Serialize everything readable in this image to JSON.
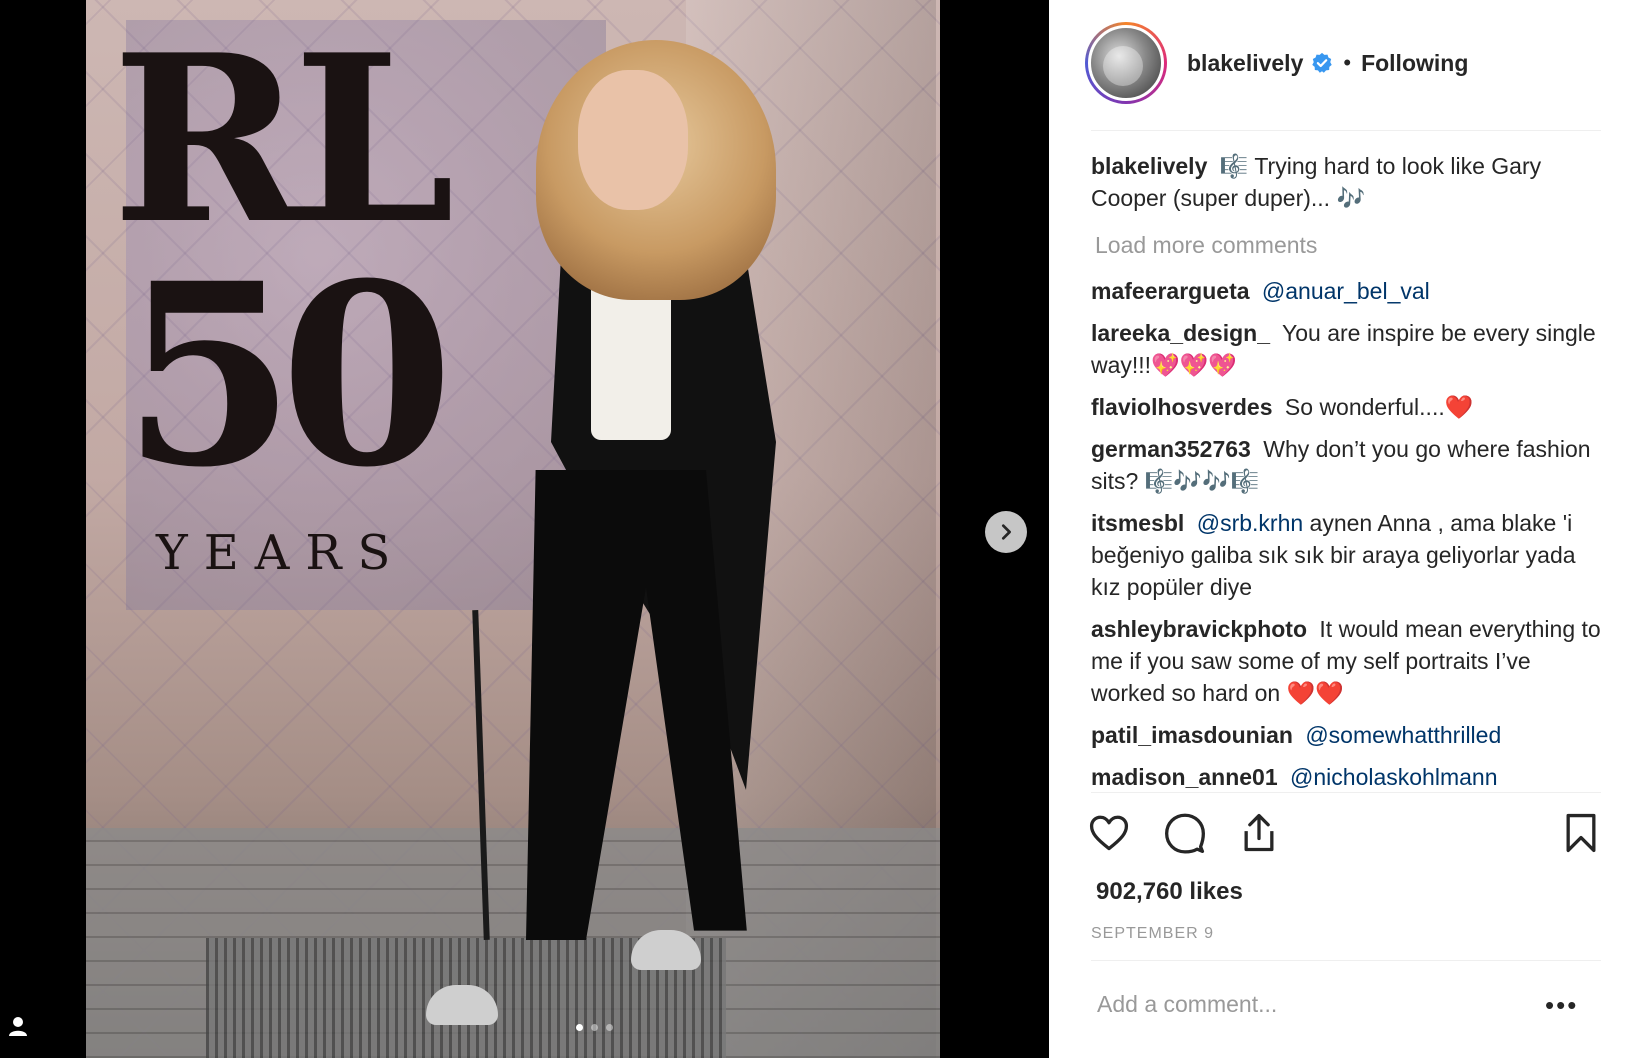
{
  "post": {
    "photo": {
      "logo_text": "RL",
      "logo_number": "50",
      "logo_subtitle": "YEARS"
    },
    "carousel": {
      "dots": 3,
      "active_index": 0
    }
  },
  "header": {
    "username": "blakelively",
    "separator": "•",
    "follow_state": "Following"
  },
  "caption": {
    "user": "blakelively",
    "text": "🎼 Trying hard to look like Gary Cooper (super duper)... 🎶"
  },
  "load_more": "Load more comments",
  "comments": [
    {
      "user": "mafeerargueta",
      "mention": "@anuar_bel_val",
      "text": ""
    },
    {
      "user": "lareeka_design_",
      "mention": "",
      "text": "You are inspire be every single way!!!💖💖💖"
    },
    {
      "user": "flaviolhosverdes",
      "mention": "",
      "text": "So wonderful....❤️"
    },
    {
      "user": "german352763",
      "mention": "",
      "text": "Why don’t you go where fashion sits? 🎼🎶🎶🎼"
    },
    {
      "user": "itsmesbl",
      "mention": "@srb.krhn",
      "text": "aynen Anna , ama blake 'i beğeniyo galiba sık sık bir araya geliyorlar yada kız popüler diye"
    },
    {
      "user": "ashleybravickphoto",
      "mention": "",
      "text": "It would mean everything to me if you saw some of my self portraits I’ve worked so hard on ❤️❤️"
    },
    {
      "user": "patil_imasdounian",
      "mention": "@somewhatthrilled",
      "text": ""
    },
    {
      "user": "madison_anne01",
      "mention": "@nicholaskohlmann",
      "text": ""
    }
  ],
  "actions": {
    "like_icon": "heart-icon",
    "comment_icon": "comment-icon",
    "share_icon": "share-icon",
    "save_icon": "bookmark-icon"
  },
  "likes": "902,760 likes",
  "date": "SEPTEMBER 9",
  "comment_input": {
    "placeholder": "Add a comment..."
  },
  "more_options": "•••",
  "colors": {
    "mention": "#003569",
    "username": "#262626",
    "muted": "#999999",
    "verified": "#3897f0"
  }
}
